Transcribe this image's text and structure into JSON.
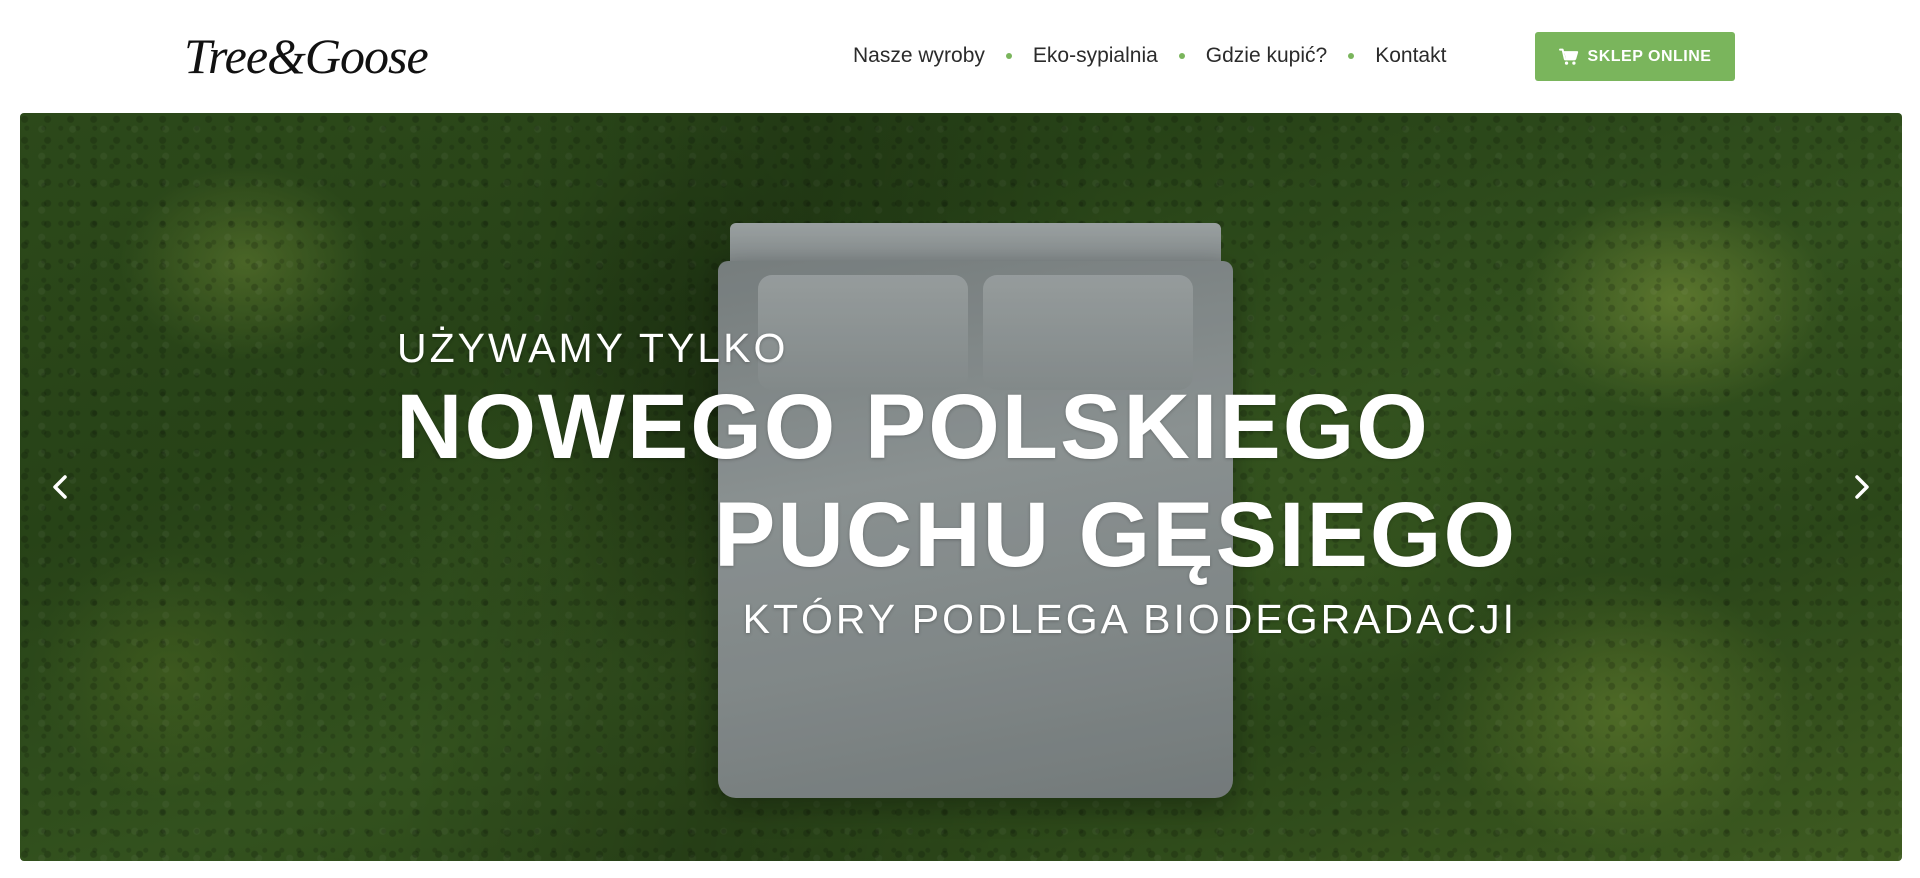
{
  "header": {
    "logo": "Tree&Goose",
    "nav": [
      {
        "label": "Nasze wyroby"
      },
      {
        "label": "Eko-sypialnia"
      },
      {
        "label": "Gdzie kupić?"
      },
      {
        "label": "Kontakt"
      }
    ],
    "shop_button": {
      "label": "SKLEP ONLINE",
      "icon": "cart-icon"
    }
  },
  "hero": {
    "eyebrow": "UŻYWAMY TYLKO",
    "headline_line1": "NOWEGO POLSKIEGO",
    "headline_line2": "PUCHU GĘSIEGO",
    "subline": "KTÓRY PODLEGA BIODEGRADACJI",
    "prev_icon": "chevron-left-icon",
    "next_icon": "chevron-right-icon"
  },
  "colors": {
    "accent": "#7ab55c",
    "nav_text": "#2b2b2b",
    "hero_text": "#ffffff"
  }
}
